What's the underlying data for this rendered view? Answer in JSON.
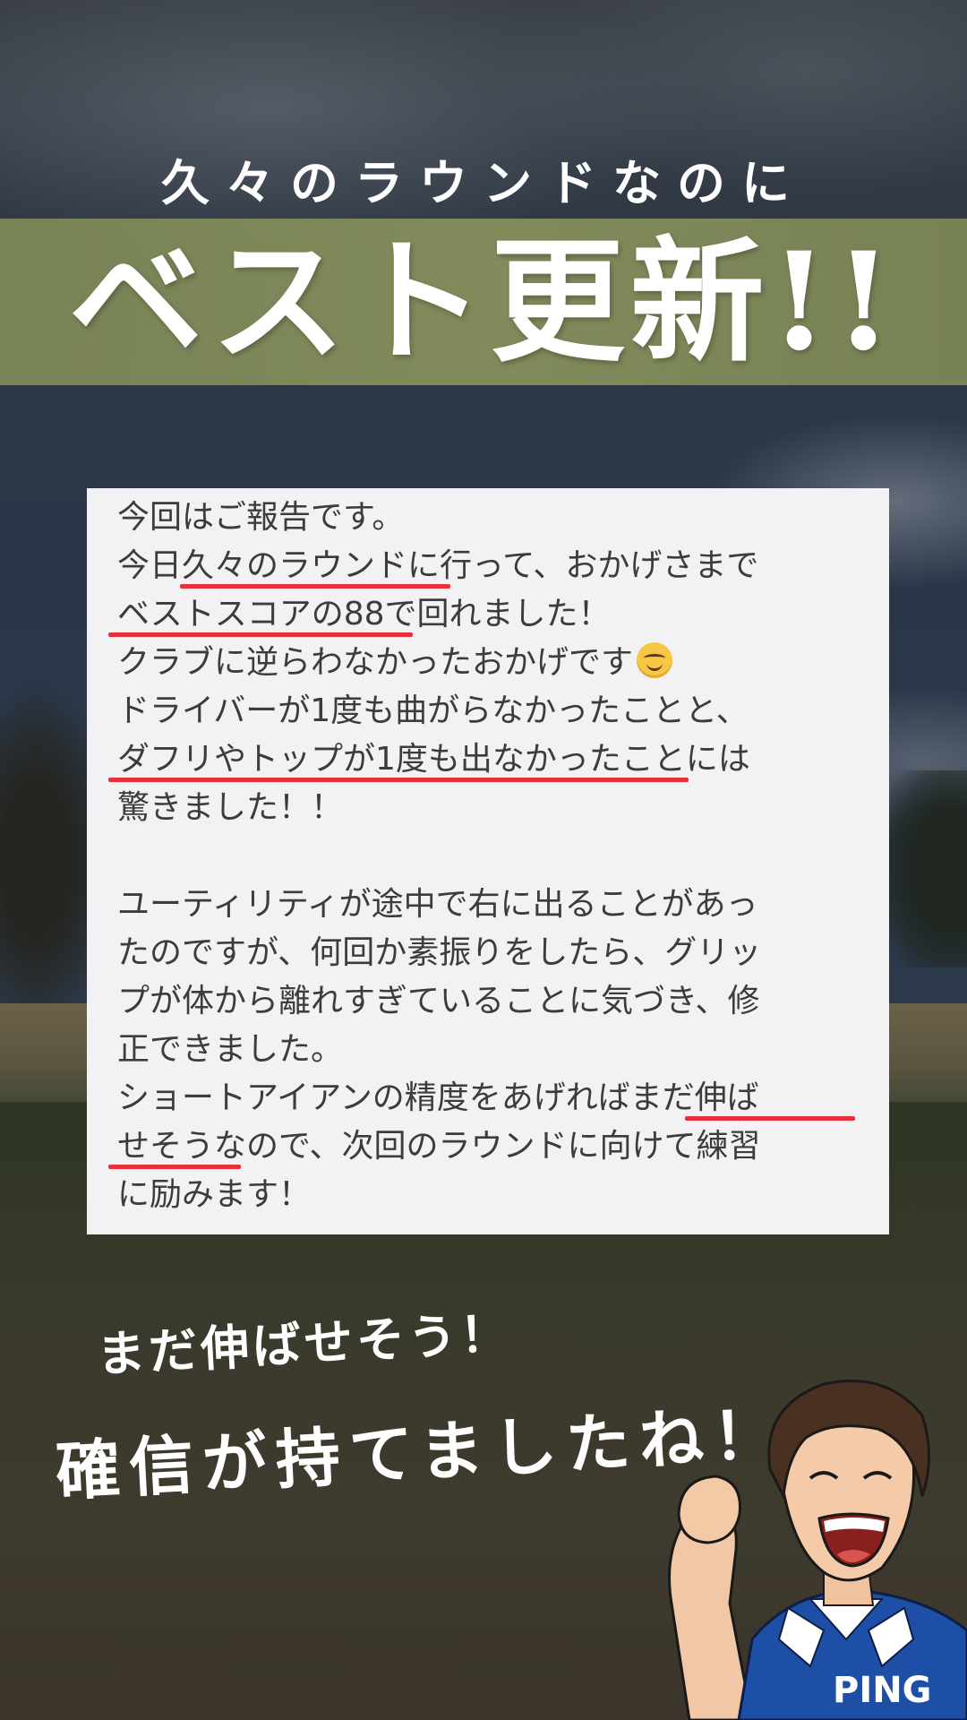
{
  "headline": {
    "subtitle": "久々のラウンドなのに",
    "title": "ベスト更新!!"
  },
  "message": {
    "lines": [
      "今回はご報告です。",
      "今日久々のラウンドに行って、おかげさまで",
      "ベストスコアの88で回れました！",
      "クラブに逆らわなかったおかげです",
      "ドライバーが1度も曲がらなかったことと、",
      "ダフリやトップが1度も出なかったことには",
      "驚きました！！",
      "",
      "ユーティリティが途中で右に出ることがあっ",
      "たのですが、何回か素振りをしたら、グリッ",
      "プが体から離れすぎていることに気づき、修",
      "正できました。",
      "ショートアイアンの精度をあげればまだ伸ば",
      "せそうなので、次回のラウンドに向けて練習",
      "に励みます！"
    ],
    "emoji": "smiling-face"
  },
  "captions": {
    "line1": "まだ伸ばせそう！",
    "line2": "確信が持てましたね！"
  },
  "character": {
    "shirt_logo": "PING"
  },
  "colors": {
    "banner": "#838e5b",
    "underline": "#e8303a",
    "card": "#f2f2f5"
  }
}
